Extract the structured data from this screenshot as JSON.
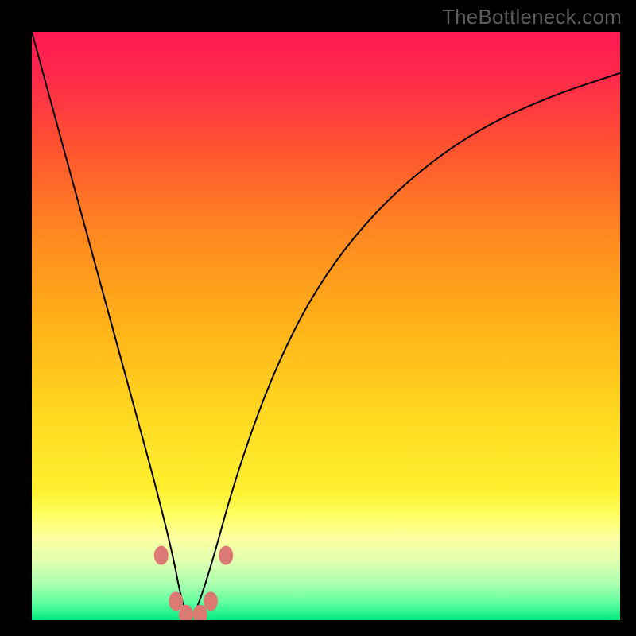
{
  "watermark": {
    "text": "TheBottleneck.com"
  },
  "gradient": {
    "stops": [
      {
        "offset": 0.0,
        "color": "#ff1a52"
      },
      {
        "offset": 0.08,
        "color": "#ff2a4a"
      },
      {
        "offset": 0.2,
        "color": "#ff5430"
      },
      {
        "offset": 0.35,
        "color": "#ff8a20"
      },
      {
        "offset": 0.5,
        "color": "#ffb218"
      },
      {
        "offset": 0.65,
        "color": "#ffd820"
      },
      {
        "offset": 0.78,
        "color": "#fff030"
      },
      {
        "offset": 0.82,
        "color": "#ffff60"
      },
      {
        "offset": 0.86,
        "color": "#fdffa0"
      },
      {
        "offset": 0.9,
        "color": "#e0ffb0"
      },
      {
        "offset": 0.94,
        "color": "#a8ffb0"
      },
      {
        "offset": 0.97,
        "color": "#60ffa0"
      },
      {
        "offset": 1.0,
        "color": "#00e880"
      }
    ]
  },
  "chart_data": {
    "type": "line",
    "title": "",
    "xlabel": "",
    "ylabel": "",
    "xlim": [
      0,
      1
    ],
    "ylim": [
      0,
      1
    ],
    "x_min_at": 0.27,
    "series": [
      {
        "name": "bottleneck-curve",
        "x": [
          0.0,
          0.03,
          0.06,
          0.09,
          0.12,
          0.15,
          0.18,
          0.21,
          0.24,
          0.255,
          0.27,
          0.285,
          0.31,
          0.34,
          0.38,
          0.42,
          0.47,
          0.53,
          0.6,
          0.68,
          0.77,
          0.88,
          1.0
        ],
        "y": [
          1.0,
          0.89,
          0.78,
          0.67,
          0.56,
          0.45,
          0.34,
          0.23,
          0.11,
          0.03,
          0.0,
          0.03,
          0.11,
          0.22,
          0.34,
          0.44,
          0.54,
          0.63,
          0.71,
          0.78,
          0.84,
          0.89,
          0.93
        ]
      }
    ],
    "markers": {
      "name": "threshold-markers",
      "color": "#db7a73",
      "points": [
        {
          "x": 0.22,
          "y": 0.11
        },
        {
          "x": 0.245,
          "y": 0.032
        },
        {
          "x": 0.262,
          "y": 0.01
        },
        {
          "x": 0.286,
          "y": 0.01
        },
        {
          "x": 0.304,
          "y": 0.032
        },
        {
          "x": 0.33,
          "y": 0.11
        }
      ]
    }
  }
}
